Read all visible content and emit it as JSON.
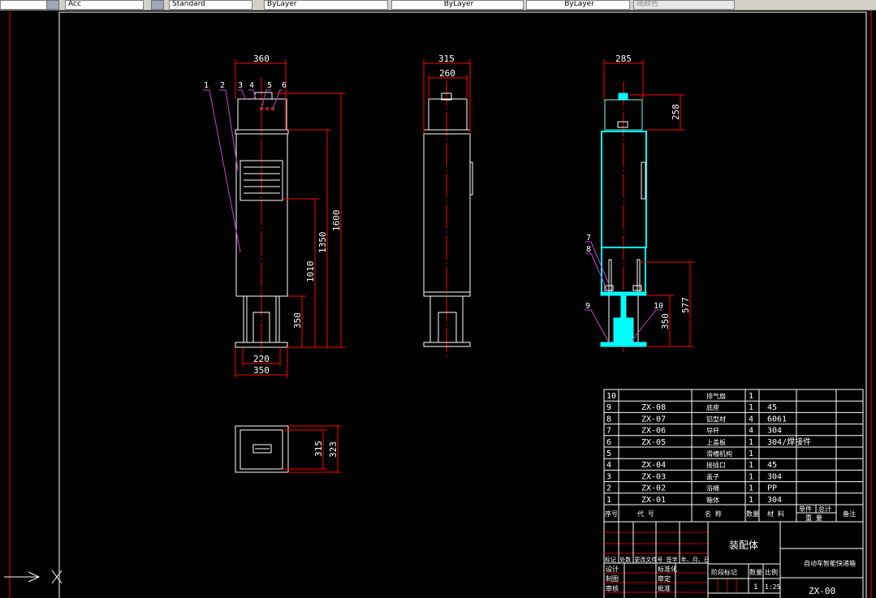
{
  "toolbar": {
    "linetype_value": "Acc",
    "textstyle_value": "Standard",
    "layer_color": "ByLayer",
    "linetype": "ByLayer",
    "lineweight": "ByLayer",
    "plotstyle": "随颜色"
  },
  "colors": {
    "background": "#000000",
    "geometry": "#ffffff",
    "dimension": "#ff0000",
    "leader": "#cc44cc",
    "side_view": "#00ffff"
  },
  "front_view": {
    "dims": {
      "width_top": "360",
      "height_total": "1600",
      "height_body": "1350",
      "height_vent": "1010",
      "height_legs": "350",
      "leg_span": "220",
      "base_width": "350"
    },
    "balloons": [
      "1",
      "2",
      "3",
      "4",
      "5",
      "6"
    ]
  },
  "side_view": {
    "dims": {
      "width": "315",
      "box_width": "260"
    }
  },
  "right_view": {
    "dims": {
      "width": "285",
      "box_height": "258",
      "lower_height": "577",
      "legs_height": "350"
    },
    "balloons": [
      "7",
      "8",
      "9",
      "10"
    ]
  },
  "top_view": {
    "dims": {
      "inner": "315",
      "outer": "323"
    }
  },
  "bom": {
    "rows": [
      {
        "no": "10",
        "code": "",
        "name": "排气扇",
        "qty": "1",
        "material": ""
      },
      {
        "no": "9",
        "code": "ZX-08",
        "name": "底座",
        "qty": "1",
        "material": "45"
      },
      {
        "no": "8",
        "code": "ZX-07",
        "name": "铝型材",
        "qty": "4",
        "material": "6061"
      },
      {
        "no": "7",
        "code": "ZX-06",
        "name": "导杆",
        "qty": "4",
        "material": "304"
      },
      {
        "no": "6",
        "code": "ZX-05",
        "name": "上盖板",
        "qty": "1",
        "material": "304/焊接件"
      },
      {
        "no": "5",
        "code": "",
        "name": "滑槽机构",
        "qty": "1",
        "material": ""
      },
      {
        "no": "4",
        "code": "ZX-04",
        "name": "接插口",
        "qty": "1",
        "material": "45"
      },
      {
        "no": "3",
        "code": "ZX-03",
        "name": "盖子",
        "qty": "1",
        "material": "304"
      },
      {
        "no": "2",
        "code": "ZX-02",
        "name": "浴桶",
        "qty": "1",
        "material": "PP"
      },
      {
        "no": "1",
        "code": "ZX-01",
        "name": "箱体",
        "qty": "1",
        "material": "304"
      }
    ],
    "headers": {
      "no": "序号",
      "code": "代  号",
      "name": "名    称",
      "qty": "数量",
      "material": "材  料",
      "single": "单件",
      "total": "总计",
      "weight": "重  量",
      "remark": "备注"
    }
  },
  "title_block": {
    "drawing_name": "装配体",
    "product_name": "自动车智能快递箱",
    "drawing_no": "ZX-00",
    "stage_label": "阶段标记",
    "qty_label": "数量",
    "scale_label": "比例",
    "qty": "1",
    "scale": "1:25",
    "revision_header": "标记 处数 更改文件号 签字 年、月、日",
    "design": "设计",
    "standardize": "标准化",
    "draw": "制图",
    "approve_check": "审定",
    "review": "审核",
    "approve": "批准"
  }
}
